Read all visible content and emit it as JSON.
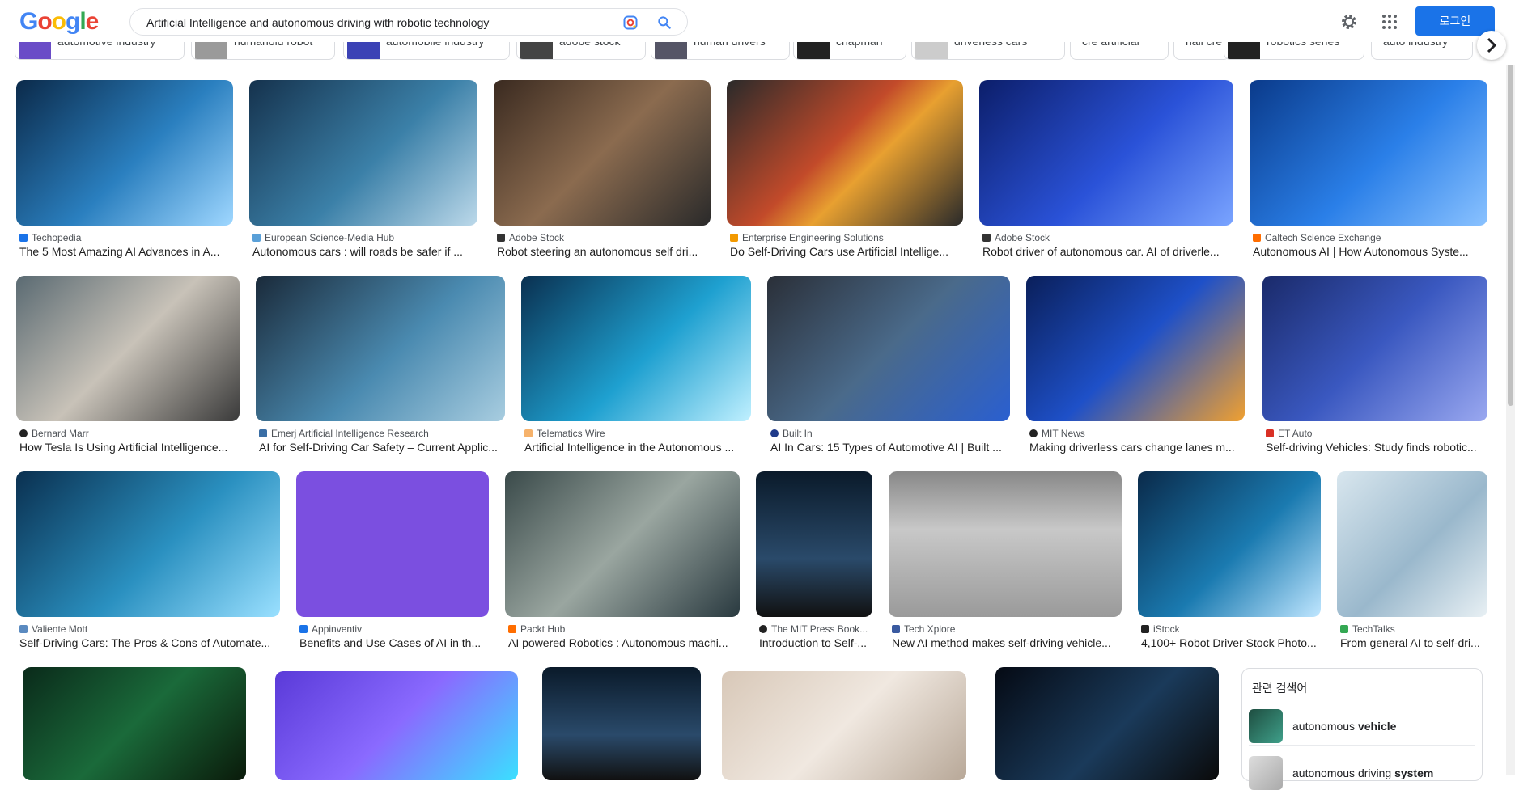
{
  "logo": "Google",
  "search": {
    "value": "Artificial Intelligence and autonomous driving with robotic technology"
  },
  "header": {
    "login_label": "로그인"
  },
  "chips": [
    "automotive industry",
    "humanoid robot",
    "automobile industry",
    "adobe stock",
    "human drivers",
    "chapman",
    "driverless cars",
    "cre artificial",
    "hall cre",
    "robotics series",
    "auto industry"
  ],
  "results": [
    {
      "source": "Techopedia",
      "title": "The 5 Most Amazing AI Advances in A..."
    },
    {
      "source": "European Science-Media Hub",
      "title": "Autonomous cars : will roads be safer if ..."
    },
    {
      "source": "Adobe Stock",
      "title": "Robot steering an autonomous self dri..."
    },
    {
      "source": "Enterprise Engineering Solutions",
      "title": "Do Self-Driving Cars use Artificial Intellige..."
    },
    {
      "source": "Adobe Stock",
      "title": "Robot driver of autonomous car. AI of driverle..."
    },
    {
      "source": "Caltech Science Exchange",
      "title": "Autonomous AI | How Autonomous Syste..."
    },
    {
      "source": "Bernard Marr",
      "title": "How Tesla Is Using Artificial Intelligence..."
    },
    {
      "source": "Emerj Artificial Intelligence Research",
      "title": "AI for Self-Driving Car Safety – Current Applic..."
    },
    {
      "source": "Telematics Wire",
      "title": "Artificial Intelligence in the Autonomous ..."
    },
    {
      "source": "Built In",
      "title": "AI In Cars: 15 Types of Automotive AI | Built ..."
    },
    {
      "source": "MIT News",
      "title": "Making driverless cars change lanes m..."
    },
    {
      "source": "ET Auto",
      "title": "Self-driving Vehicles: Study finds robotic..."
    },
    {
      "source": "Valiente Mott",
      "title": "Self-Driving Cars: The Pros & Cons of Automate..."
    },
    {
      "source": "Appinventiv",
      "title": "Benefits and Use Cases of AI in th..."
    },
    {
      "source": "Packt Hub",
      "title": "AI powered Robotics : Autonomous machi..."
    },
    {
      "source": "The MIT Press Book...",
      "title": "Introduction to Self-..."
    },
    {
      "source": "Tech Xplore",
      "title": "New AI method makes self-driving vehicle..."
    },
    {
      "source": "iStock",
      "title": "4,100+ Robot Driver Stock Photo..."
    },
    {
      "source": "TechTalks",
      "title": "From general AI to self-dri..."
    }
  ],
  "related": {
    "heading": "관련 검색어",
    "items": [
      {
        "prefix": "autonomous ",
        "bold": "vehicle"
      },
      {
        "prefix": "autonomous driving ",
        "bold": "system"
      }
    ]
  }
}
